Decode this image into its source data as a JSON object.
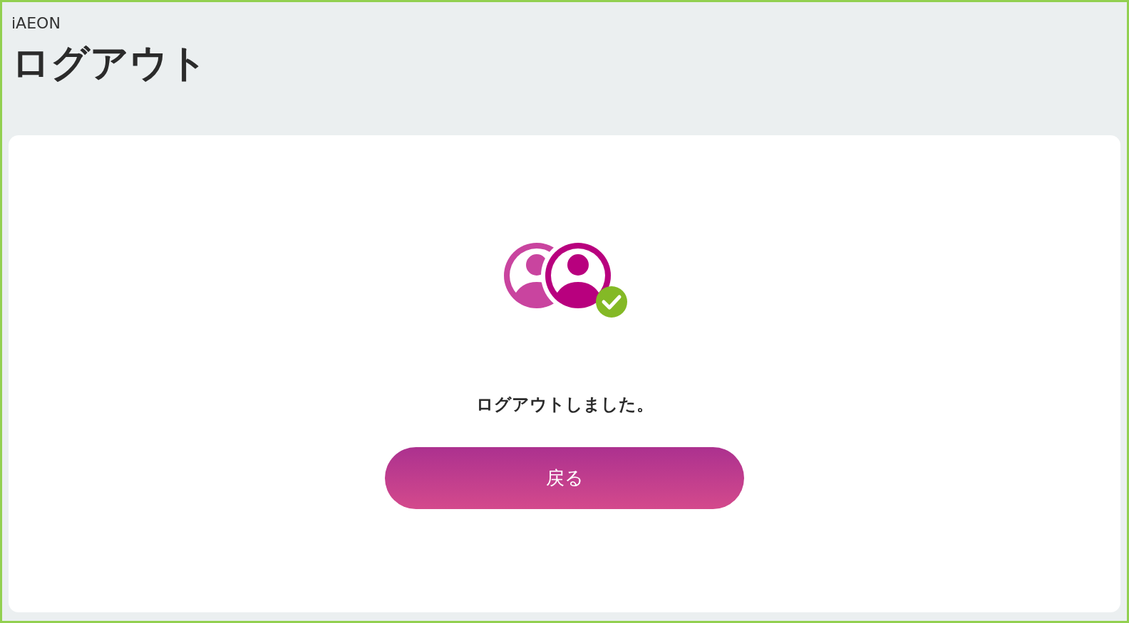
{
  "header": {
    "site": "iAEON",
    "title": "ログアウト"
  },
  "card": {
    "message": "ログアウトしました。",
    "button": "戻る"
  }
}
